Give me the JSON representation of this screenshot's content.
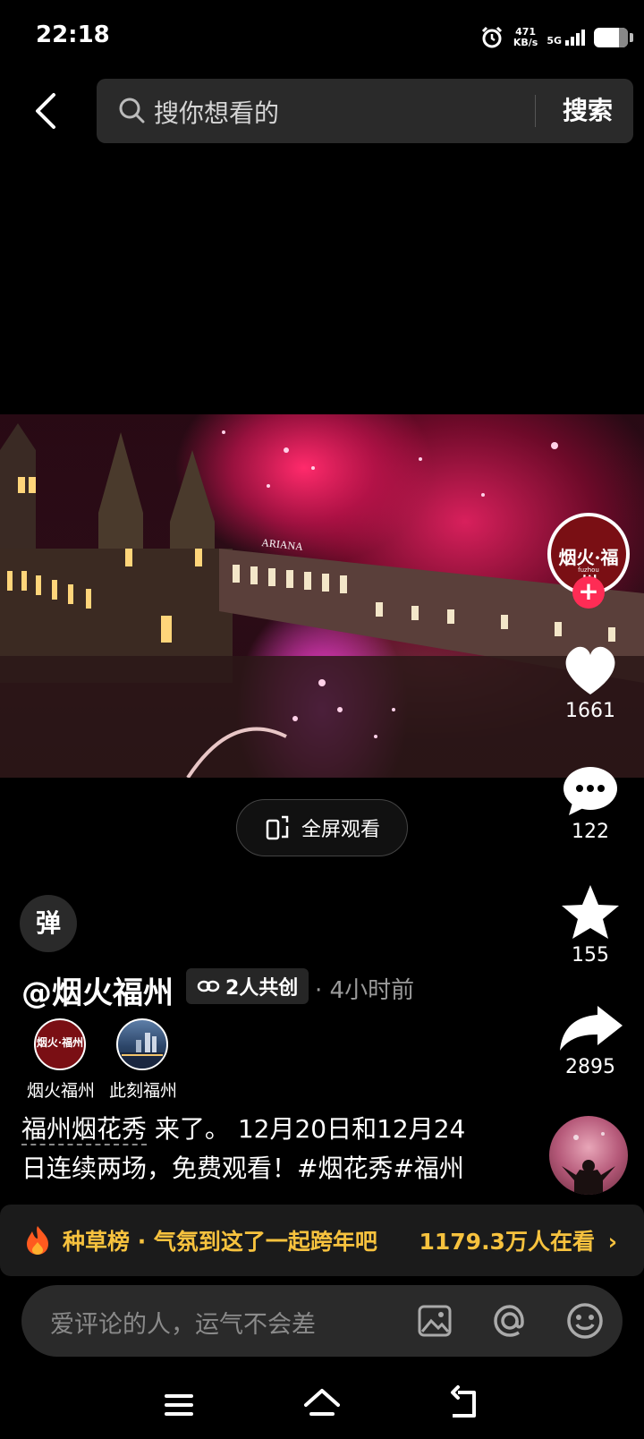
{
  "status_bar": {
    "time": "22:18",
    "net_speed_value": "471",
    "net_speed_unit": "KB/s",
    "network": "5G"
  },
  "search": {
    "placeholder": "搜你想看的",
    "button_label": "搜索"
  },
  "video": {
    "building_sign": "ARIANA"
  },
  "fullscreen": {
    "label": "全屏观看"
  },
  "author_avatar": {
    "logo_text": "烟火·福州",
    "logo_sub": "fuzhou"
  },
  "actions": {
    "like_count": "1661",
    "comment_count": "122",
    "favorite_count": "155",
    "share_count": "2895"
  },
  "danmaku": {
    "label": "弹"
  },
  "post": {
    "author": "@烟火福州",
    "cocreate_label": "2人共创",
    "time": "· 4小时前",
    "cocreators": [
      {
        "name": "烟火福州"
      },
      {
        "name": "此刻福州"
      }
    ],
    "description_link": "福州烟花秀",
    "description_line1": " 来了。 12月20日和12月24",
    "description_line2": "日连续两场，免费观看！#烟花秀#福州"
  },
  "hot_bar": {
    "label": "种草榜 · 气氛到这了一起跨年吧",
    "viewers": "1179.3万人在看",
    "arrow": "›"
  },
  "comment": {
    "placeholder": "爱评论的人，运气不会差"
  },
  "icons": {
    "back": "chevron-left-icon",
    "search": "search-icon",
    "like": "heart-icon",
    "comment": "chat-bubble-icon",
    "favorite": "star-icon",
    "share": "share-arrow-icon",
    "hot": "flame-icon",
    "image": "image-icon",
    "mention": "at-icon",
    "emoji": "emoji-icon",
    "menu": "menu-icon",
    "home": "home-icon",
    "back_nav": "back-icon"
  },
  "colors": {
    "accent": "#fe2c55",
    "hot_text": "#f7c23e",
    "background": "#000000"
  }
}
